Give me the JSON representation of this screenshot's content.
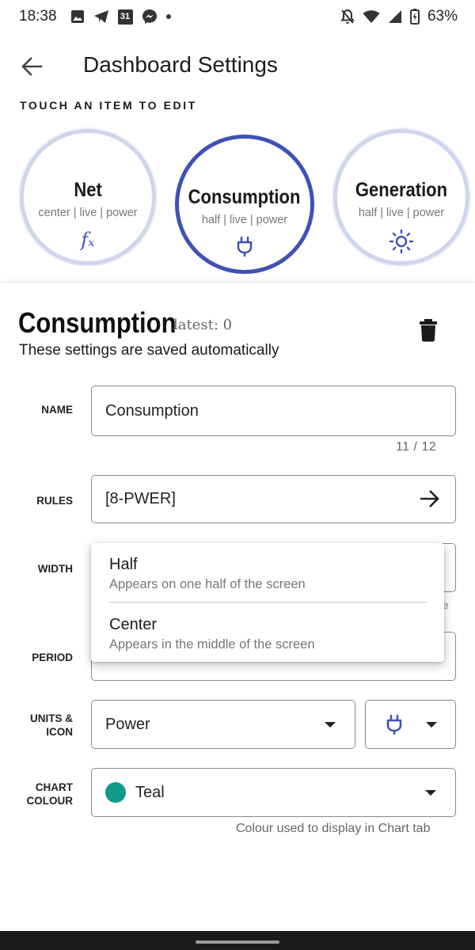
{
  "status_bar": {
    "time": "18:38",
    "calendar_day": "31",
    "battery": "63%"
  },
  "app_bar": {
    "title": "Dashboard Settings"
  },
  "subtitle": "TOUCH AN ITEM TO EDIT",
  "items": [
    {
      "title": "Net",
      "subtitle": "center | live | power",
      "icon": "fx-icon"
    },
    {
      "title": "Consumption",
      "subtitle": "half | live | power",
      "icon": "plug-icon",
      "selected": true
    },
    {
      "title": "Generation",
      "subtitle": "half | live | power",
      "icon": "sun-icon"
    }
  ],
  "editor": {
    "title": "Consumption",
    "latest": "latest: 0",
    "saved_note": "These settings are saved automatically",
    "name_label": "NAME",
    "name_value": "Consumption",
    "name_counter": "11 / 12",
    "rules_label": "RULES",
    "rules_value": "[8-PWER]",
    "width_label": "WIDTH",
    "period_label": "PERIOD",
    "units_label_1": "UNITS &",
    "units_label_2": "ICON",
    "units_value": "Power",
    "colour_label_1": "CHART",
    "colour_label_2": "COLOUR",
    "colour_value": "Teal",
    "colour_swatch": "#0f9a8a",
    "colour_helper": "Colour used to display in Chart tab"
  },
  "width_menu": {
    "options": [
      {
        "title": "Half",
        "description": "Appears on one half of the screen"
      },
      {
        "title": "Center",
        "description": "Appears in the middle of the screen"
      }
    ]
  },
  "colors": {
    "accent": "#3f51b5",
    "ring_inactive": "#cfd5ec"
  }
}
